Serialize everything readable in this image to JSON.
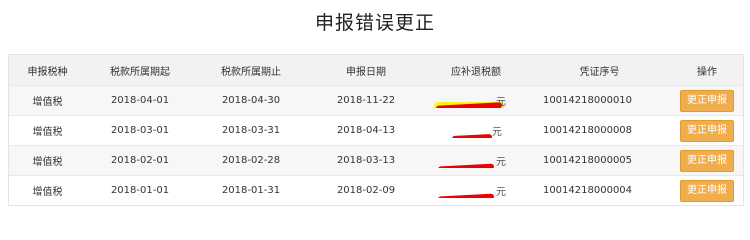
{
  "page": {
    "title": "申报错误更正"
  },
  "table": {
    "headers": [
      "申报税种",
      "税款所属期起",
      "税款所属期止",
      "申报日期",
      "应补退税额",
      "凭证序号",
      "操作"
    ],
    "rows": [
      {
        "tax_type": "增值税",
        "period_start": "2018-04-01",
        "period_end": "2018-04-30",
        "filing_date": "2018-11-22",
        "amount": "元",
        "voucher": "10014218000010",
        "action": "更正申报"
      },
      {
        "tax_type": "增值税",
        "period_start": "2018-03-01",
        "period_end": "2018-03-31",
        "filing_date": "2018-04-13",
        "amount": "元",
        "voucher": "10014218000008",
        "action": "更正申报"
      },
      {
        "tax_type": "增值税",
        "period_start": "2018-02-01",
        "period_end": "2018-02-28",
        "filing_date": "2018-03-13",
        "amount": "元",
        "voucher": "10014218000005",
        "action": "更正申报"
      },
      {
        "tax_type": "增值税",
        "period_start": "2018-01-01",
        "period_end": "2018-01-31",
        "filing_date": "2018-02-09",
        "amount": "元",
        "voucher": "10014218000004",
        "action": "更正申报"
      }
    ]
  },
  "colors": {
    "button": "#f0ad4e",
    "redaction": "#ee0000",
    "highlight": "#fff200"
  }
}
